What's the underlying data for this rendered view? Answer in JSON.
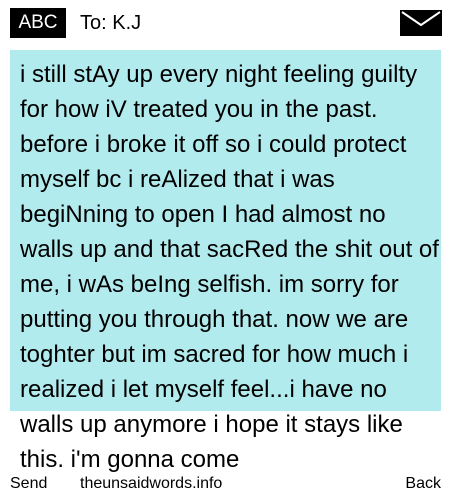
{
  "header": {
    "badge_label": "ABC",
    "recipient": "To: K.J"
  },
  "message": {
    "text": "i still stAy up every night feeling guilty for how iV treated you in the past. before i broke it off so i could protect myself bc i reAlized that i was begiNning to open I had almost no walls up and that sacRed the shit out of me, i wAs beIng selfish. im sorry for putting you through that. now we are toghter but im sacred for how much i realized i let myself feel...i have no walls up anymore i hope it stays like this. i'm gonna come"
  },
  "softkeys": {
    "left": "Send",
    "center": "theunsaidwords.info",
    "right": "Back"
  },
  "colors": {
    "message_background": "#b2ebee",
    "badge_background": "#000000"
  },
  "icons": {
    "envelope": "envelope-icon"
  }
}
